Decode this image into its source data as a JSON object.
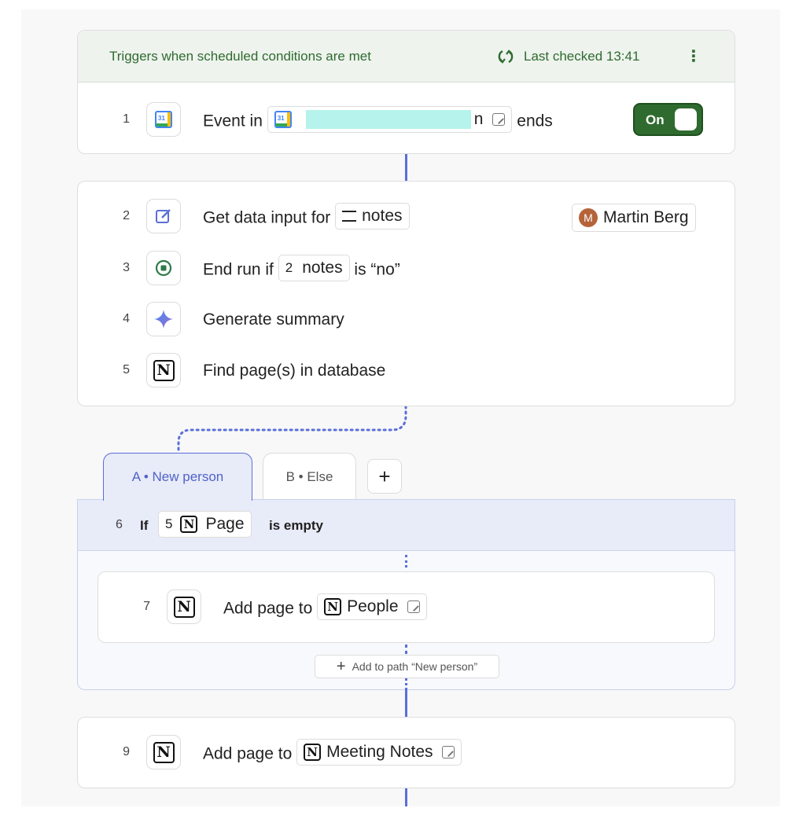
{
  "trigger": {
    "condition_text": "Triggers when scheduled conditions are met",
    "last_checked": "Last checked 13:41",
    "more_glyph": "⋮",
    "toggle_label": "On",
    "step": {
      "num": "1",
      "before": "Event in",
      "chip_text": "n",
      "after": "ends"
    }
  },
  "steps": {
    "s2": {
      "num": "2",
      "label": "Get data input for",
      "chip": "notes",
      "assignee_initial": "M",
      "assignee": "Martin Berg"
    },
    "s3": {
      "num": "3",
      "label": "End run if",
      "chip_num": "2",
      "chip": "notes",
      "suffix": "is “no”"
    },
    "s4": {
      "num": "4",
      "label": "Generate summary"
    },
    "s5": {
      "num": "5",
      "label": "Find page(s) in database"
    }
  },
  "branches": {
    "tab_a": "A • New person",
    "tab_b": "B • Else",
    "add_tab": "+",
    "condition": {
      "num": "6",
      "if": "If",
      "chip_num": "5",
      "chip": "Page",
      "suffix": "is empty"
    },
    "step7": {
      "num": "7",
      "label": "Add page to",
      "chip": "People"
    },
    "add_to_path": "Add to path “New person”"
  },
  "step9": {
    "num": "9",
    "label": "Add page to",
    "chip": "Meeting Notes"
  },
  "icons": {
    "notion": "N",
    "plus": "+"
  },
  "colors": {
    "accent": "#5a6fd8",
    "toggle_green": "#2f6b2f",
    "trigger_text": "#2f6b2f",
    "avatar": "#b5643a"
  }
}
